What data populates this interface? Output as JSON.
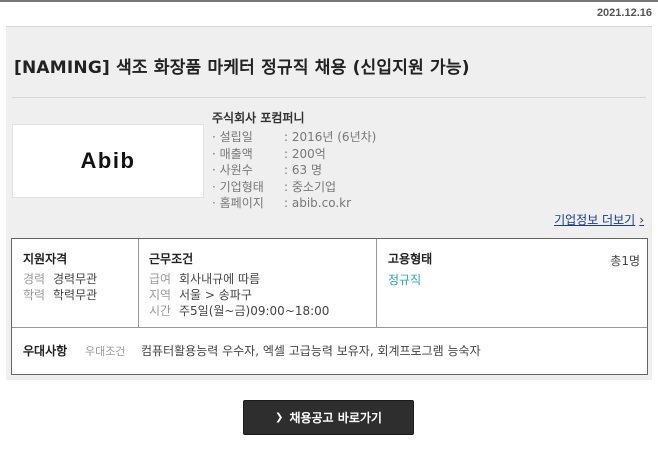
{
  "post_date": "2021.12.16",
  "job_title": "[NAMING] 색조 화장품 마케터 정규직 채용 (신입지원 가능)",
  "company": {
    "logo_text": "Abib",
    "name": "주식회사 포컴퍼니",
    "facts": [
      {
        "label": "· 설립일",
        "value": ": 2016년 (6년차)"
      },
      {
        "label": "· 매출액",
        "value": ": 200억"
      },
      {
        "label": "· 사원수",
        "value": ": 63 명"
      },
      {
        "label": "· 기업형태",
        "value": ": 중소기업"
      },
      {
        "label": "· 홈페이지",
        "value": ": abib.co.kr"
      }
    ],
    "info_link": "기업정보 더보기"
  },
  "requirements": {
    "qualification": {
      "title": "지원자격",
      "rows": [
        {
          "key": "경력",
          "value": "경력무관"
        },
        {
          "key": "학력",
          "value": "학력무관"
        }
      ]
    },
    "conditions": {
      "title": "근무조건",
      "rows": [
        {
          "key": "급여",
          "value": "회사내규에 따름"
        },
        {
          "key": "지역",
          "value": "서울 > 송파구"
        },
        {
          "key": "시간",
          "value": "주5일(월~금)09:00~18:00"
        }
      ]
    },
    "employment": {
      "title": "고용형태",
      "value": "정규직",
      "headcount": "총1명"
    },
    "preferred": {
      "title": "우대사항",
      "key": "우대조건",
      "value": "컴퓨터활용능력 우수자, 엑셀 고급능력 보유자, 회계프로그램 능숙자"
    }
  },
  "cta_label": "채용공고 바로가기"
}
